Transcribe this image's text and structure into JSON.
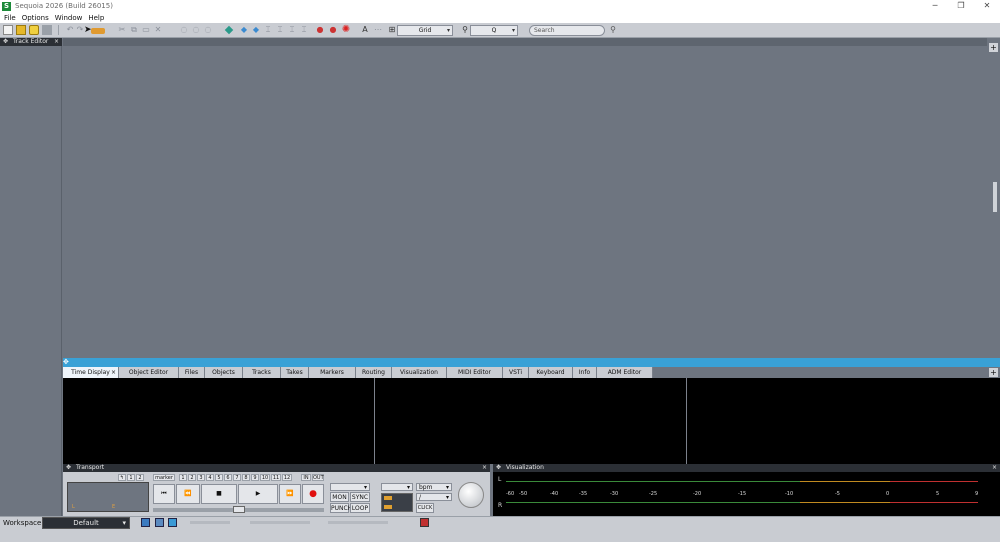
{
  "window": {
    "title": "Sequoia 2026 (Build 26015)",
    "logo": "S",
    "minimize": "─",
    "restore": "❐",
    "close": "✕"
  },
  "menu": [
    "File",
    "Options",
    "Window",
    "Help"
  ],
  "toolbar": {
    "snap_select": "Grid",
    "zoom_select": "Q",
    "search_placeholder": "Search"
  },
  "left_panel": {
    "title": "Track Editor",
    "close": "×"
  },
  "tabs": [
    {
      "label": "Time Display",
      "active": true
    },
    {
      "label": "Object Editor"
    },
    {
      "label": "Files"
    },
    {
      "label": "Objects"
    },
    {
      "label": "Tracks"
    },
    {
      "label": "Takes"
    },
    {
      "label": "Markers"
    },
    {
      "label": "Routing"
    },
    {
      "label": "Visualization"
    },
    {
      "label": "MIDI Editor"
    },
    {
      "label": "VSTi"
    },
    {
      "label": "Keyboard"
    },
    {
      "label": "Info"
    },
    {
      "label": "ADM Editor"
    }
  ],
  "transport": {
    "title": "Transport",
    "marker_label": "marker",
    "counter_labels": [
      "↰",
      "1",
      "2"
    ],
    "marker_numbers": [
      "1",
      "2",
      "3",
      "4",
      "5",
      "6",
      "7",
      "8",
      "9",
      "10",
      "11",
      "12"
    ],
    "in_label": "IN",
    "out_label": "OUT",
    "display_l": "L",
    "display_e": "E",
    "buttons": {
      "to_start": "⏮",
      "rewind": "⏪",
      "stop": "■",
      "play": "▶",
      "forward": "⏩",
      "record": "●"
    },
    "mon": "MON",
    "sync": "SYNC",
    "punch": "PUNCH",
    "loop": "LOOP",
    "bpm": "bpm",
    "slash": "/",
    "click": "CLICK"
  },
  "visualization": {
    "title": "Visualization",
    "channel_l": "L",
    "channel_r": "R",
    "scale": [
      "-60",
      "-50",
      "-40",
      "-35",
      "-30",
      "-25",
      "-20",
      "-15",
      "-10",
      "-5",
      "0",
      "5",
      "9"
    ]
  },
  "statusbar": {
    "workspace_label": "Workspace:",
    "workspace_value": "Default"
  },
  "add": "+"
}
